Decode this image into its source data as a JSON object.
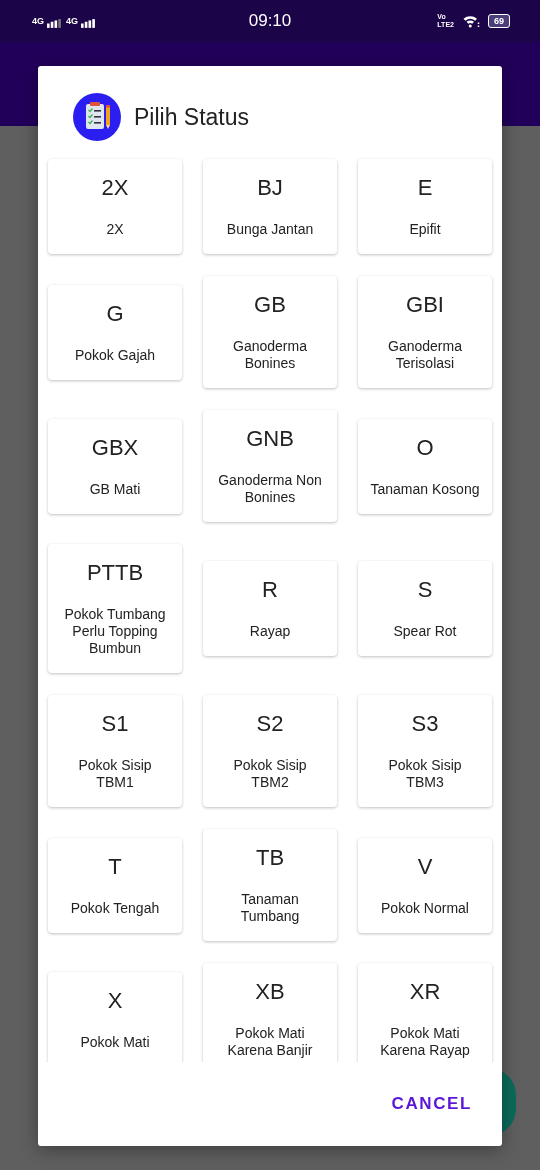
{
  "status_bar": {
    "sim_1": "4G",
    "sim_2": "4G",
    "time": "09:10",
    "volte": "Vo",
    "lte": "LTE2",
    "battery": "69"
  },
  "dialog": {
    "title": "Pilih Status",
    "options": [
      {
        "code": "2X",
        "label": "2X"
      },
      {
        "code": "BJ",
        "label": "Bunga Jantan"
      },
      {
        "code": "E",
        "label": "Epifit"
      },
      {
        "code": "G",
        "label": "Pokok Gajah"
      },
      {
        "code": "GB",
        "label": "Ganoderma\nBonines"
      },
      {
        "code": "GBI",
        "label": "Ganoderma\nTerisolasi"
      },
      {
        "code": "GBX",
        "label": "GB Mati"
      },
      {
        "code": "GNB",
        "label": "Ganoderma Non\nBonines"
      },
      {
        "code": "O",
        "label": "Tanaman Kosong"
      },
      {
        "code": "PTTB",
        "label": "Pokok Tumbang\nPerlu Topping\nBumbun"
      },
      {
        "code": "R",
        "label": "Rayap"
      },
      {
        "code": "S",
        "label": "Spear Rot"
      },
      {
        "code": "S1",
        "label": "Pokok Sisip\nTBM1"
      },
      {
        "code": "S2",
        "label": "Pokok Sisip\nTBM2"
      },
      {
        "code": "S3",
        "label": "Pokok Sisip\nTBM3"
      },
      {
        "code": "T",
        "label": "Pokok Tengah"
      },
      {
        "code": "TB",
        "label": "Tanaman\nTumbang"
      },
      {
        "code": "V",
        "label": "Pokok Normal"
      },
      {
        "code": "X",
        "label": "Pokok Mati"
      },
      {
        "code": "XB",
        "label": "Pokok Mati\nKarena Banjir"
      },
      {
        "code": "XR",
        "label": "Pokok Mati\nKarena Rayap"
      }
    ],
    "cancel": "CANCEL"
  }
}
